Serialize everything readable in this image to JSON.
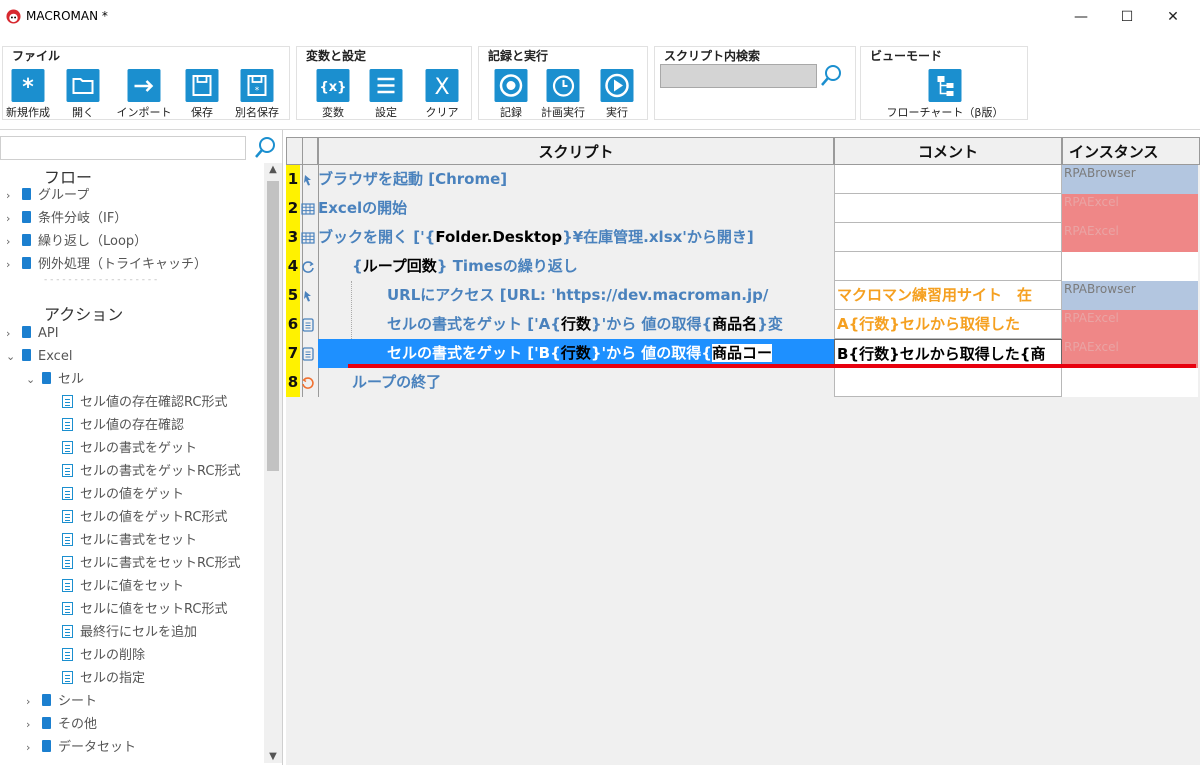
{
  "window": {
    "title": "MACROMAN *",
    "minimize": "—",
    "maximize": "☐",
    "close": "✕"
  },
  "ribbon": {
    "file_group": {
      "label": "ファイル",
      "buttons": [
        "新規作成",
        "開く",
        "インポート",
        "保存",
        "別名保存"
      ]
    },
    "vars_group": {
      "label": "変数と設定",
      "buttons": [
        "変数",
        "設定",
        "クリア"
      ]
    },
    "rec_group": {
      "label": "記録と実行",
      "buttons": [
        "記録",
        "計画実行",
        "実行"
      ]
    },
    "search_group": {
      "label": "スクリプト内検索",
      "value": ""
    },
    "view_group": {
      "label": "ビューモード",
      "buttons": [
        "フローチャート（β版）"
      ]
    }
  },
  "left_panel": {
    "search_value": "",
    "sections": {
      "flow": "フロー",
      "action": "アクション"
    },
    "flow_items": [
      "グループ",
      "条件分岐（IF）",
      "繰り返し（Loop）",
      "例外処理（トライキャッチ）"
    ],
    "separator": "- - - - - - - - - - - - - - - - - - -",
    "action_items": [
      "API",
      "Excel"
    ],
    "excel_children": [
      "セル"
    ],
    "cell_items": [
      "セル値の存在確認RC形式",
      "セル値の存在確認",
      "セルの書式をゲット",
      "セルの書式をゲットRC形式",
      "セルの値をゲット",
      "セルの値をゲットRC形式",
      "セルに書式をセット",
      "セルに書式をセットRC形式",
      "セルに値をセット",
      "セルに値をセットRC形式",
      "最終行にセルを追加",
      "セルの削除",
      "セルの指定"
    ],
    "excel_other": [
      "シート",
      "その他",
      "データセット"
    ]
  },
  "grid": {
    "headers": {
      "script": "スクリプト",
      "comment": "コメント",
      "instance": "インスタンス"
    },
    "rows": [
      {
        "num": "1",
        "p1": "ブラウザを起動 [Chrome]",
        "comment": "",
        "instance": "RPABrowser",
        "itype": "browser"
      },
      {
        "num": "2",
        "p1": "Excelの開始",
        "comment": "",
        "instance": "RPAExcel",
        "itype": "excel"
      },
      {
        "num": "3",
        "p1": "ブックを開く ['{",
        "p2": "Folder.Desktop",
        "p3": "}¥在庫管理.xlsx'から開き]",
        "comment": "",
        "instance": "RPAExcel",
        "itype": "excel"
      },
      {
        "num": "4",
        "p1": "{",
        "p2": "ループ回数",
        "p3": "} Timesの繰り返し",
        "comment": "",
        "instance": "",
        "itype": "none"
      },
      {
        "num": "5",
        "p1": "URLにアクセス [URL: 'https://dev.macroman.jp/",
        "comment": "マクロマン練習用サイト　在",
        "instance": "RPABrowser",
        "itype": "browser"
      },
      {
        "num": "6",
        "p1": "セルの書式をゲット ['A{",
        "p2": "行数",
        "p3": "}'から 値の取得{",
        "p4": "商品名",
        "p5": "}変",
        "comment": "A{行数}セルから取得した",
        "instance": "RPAExcel",
        "itype": "excel"
      },
      {
        "num": "7",
        "p1": "セルの書式をゲット ['B{",
        "p2": "行数",
        "p3": "}'から 値の取得{",
        "p4": "商品コー",
        "comment": "B{行数}セルから取得した{商",
        "instance": "RPAExcel",
        "itype": "excel"
      },
      {
        "num": "8",
        "p1": "ループの終了",
        "comment": "",
        "instance": "",
        "itype": "none"
      }
    ]
  },
  "colors": {
    "accent": "#1b8fcf",
    "script_text": "#4a82bd",
    "selection": "#1e90ff",
    "line_number_bg": "#fff200",
    "comment_text": "#f5a020",
    "instance_browser": "#b3c6e0",
    "instance_excel": "#ef8787",
    "drop_marker": "#e8000e"
  }
}
